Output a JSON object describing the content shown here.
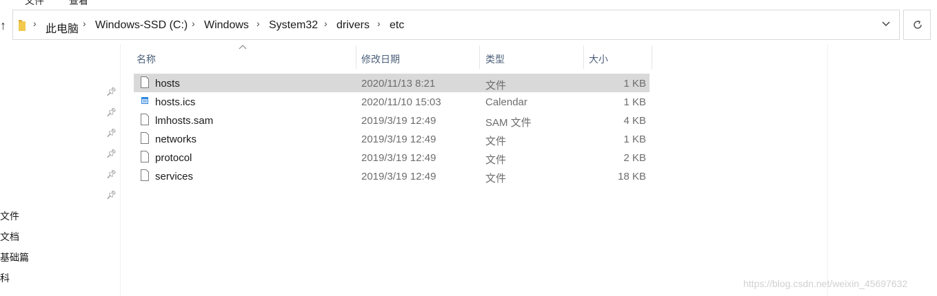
{
  "ribbon": {
    "item1": "文件",
    "item2": "查看"
  },
  "address_bar": {
    "crumbs": [
      "此电脑",
      "Windows-SSD (C:)",
      "Windows",
      "System32",
      "drivers",
      "etc"
    ]
  },
  "nav": {
    "items": [
      "文件",
      "文档",
      "基础篇",
      "科"
    ]
  },
  "columns": {
    "name": "名称",
    "date": "修改日期",
    "type": "类型",
    "size": "大小"
  },
  "files": [
    {
      "name": "hosts",
      "date": "2020/11/13 8:21",
      "type": "文件",
      "size": "1 KB",
      "icon": "generic-file-icon",
      "selected": true
    },
    {
      "name": "hosts.ics",
      "date": "2020/11/10 15:03",
      "type": "Calendar",
      "size": "1 KB",
      "icon": "calendar-file-icon",
      "selected": false
    },
    {
      "name": "lmhosts.sam",
      "date": "2019/3/19 12:49",
      "type": "SAM 文件",
      "size": "4 KB",
      "icon": "generic-file-icon",
      "selected": false
    },
    {
      "name": "networks",
      "date": "2019/3/19 12:49",
      "type": "文件",
      "size": "1 KB",
      "icon": "generic-file-icon",
      "selected": false
    },
    {
      "name": "protocol",
      "date": "2019/3/19 12:49",
      "type": "文件",
      "size": "2 KB",
      "icon": "generic-file-icon",
      "selected": false
    },
    {
      "name": "services",
      "date": "2019/3/19 12:49",
      "type": "文件",
      "size": "18 KB",
      "icon": "generic-file-icon",
      "selected": false
    }
  ],
  "watermark": "https://blog.csdn.net/weixin_45697632",
  "colors": {
    "selected_row": "#d9d9d9",
    "header_text": "#4c607a",
    "secondary_text": "#6d6d6d"
  }
}
